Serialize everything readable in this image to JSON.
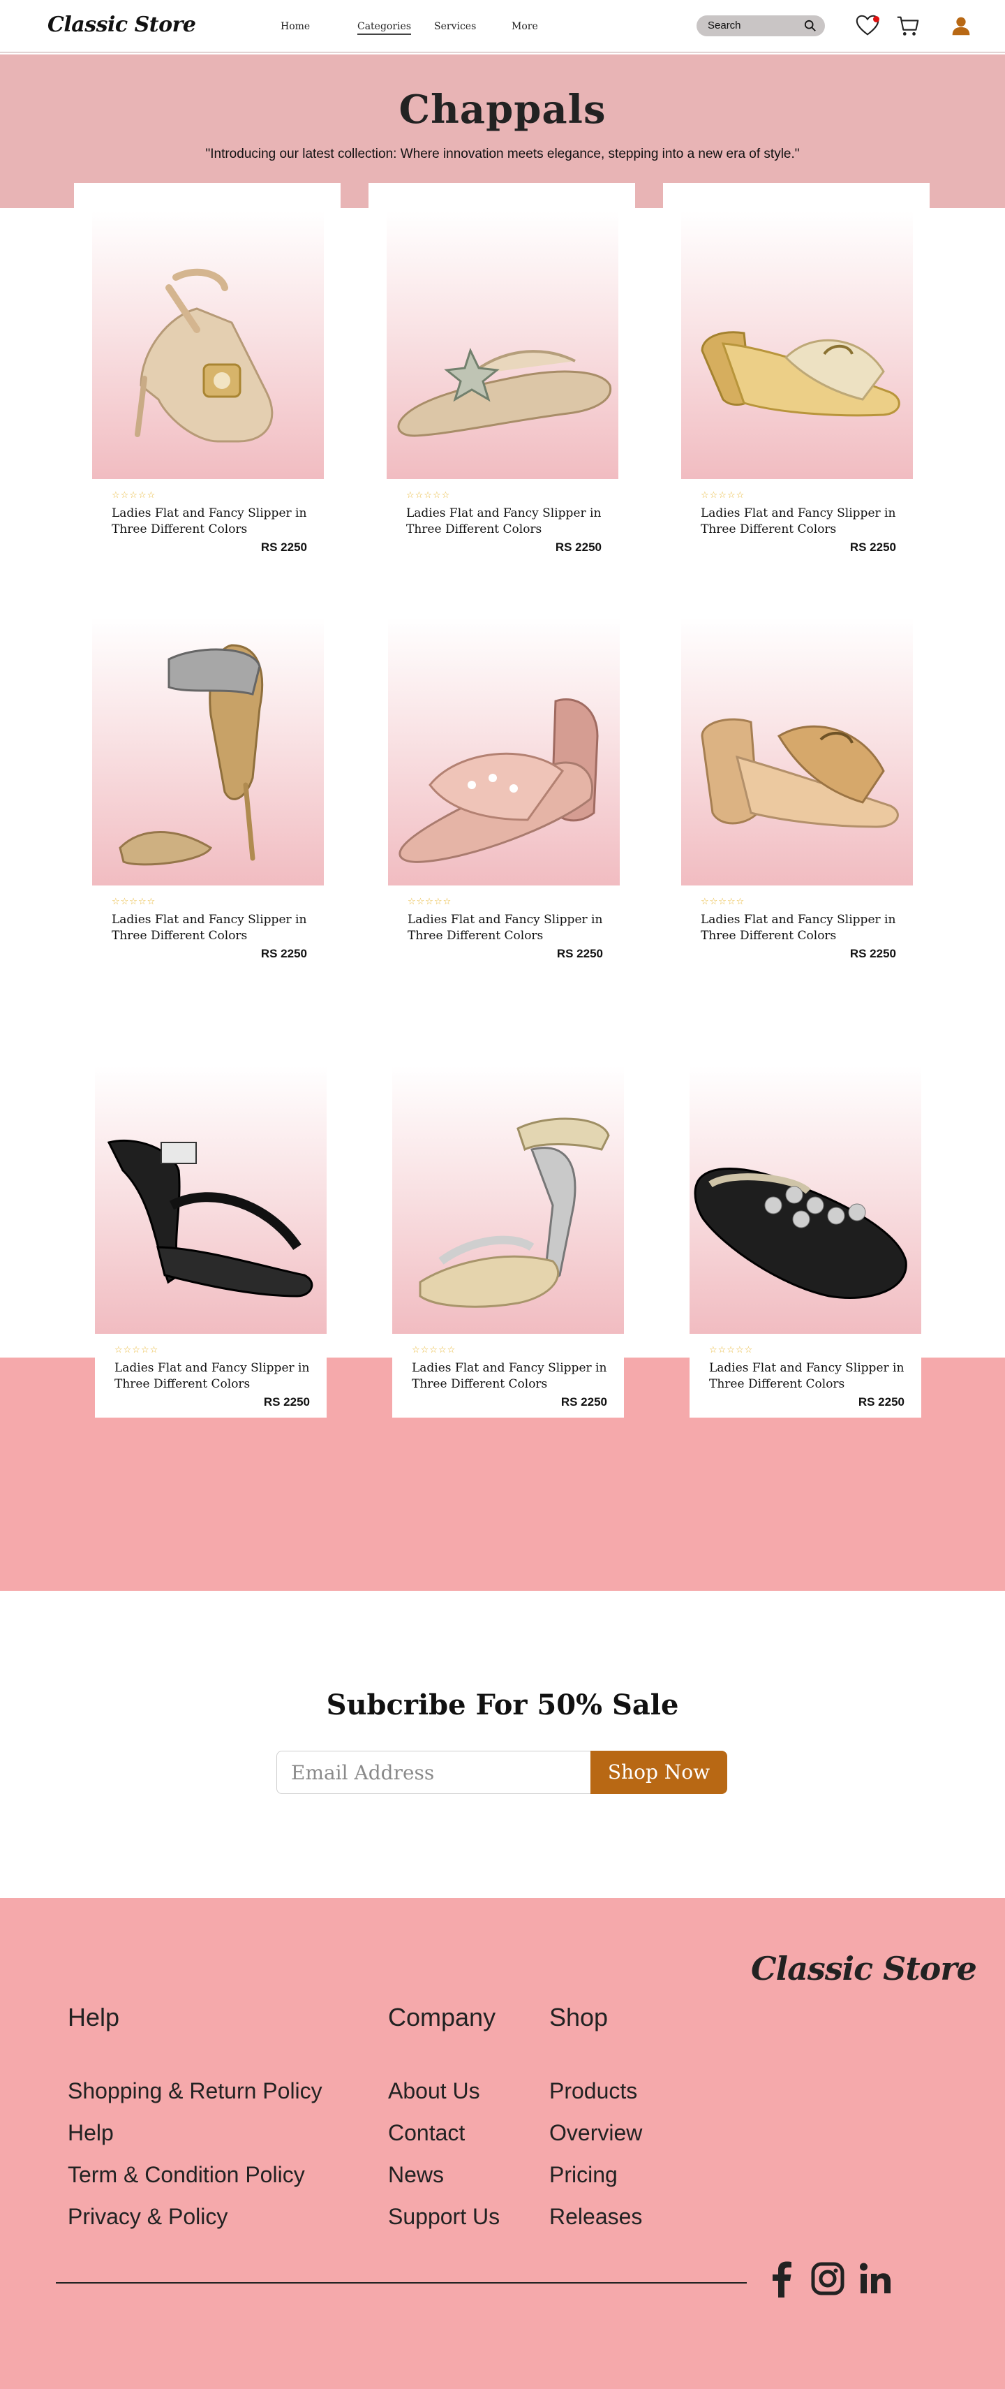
{
  "header": {
    "logo": "Classic Store",
    "nav": [
      "Home",
      "Categories",
      "Services",
      "More"
    ],
    "active_nav": "Categories",
    "search_placeholder": "Search",
    "icons": [
      "heart-icon",
      "cart-icon",
      "user-icon"
    ]
  },
  "hero": {
    "title": "Chappals",
    "subtitle": "\"Introducing our latest collection: Where innovation meets elegance, stepping into a new era of style.\""
  },
  "products": [
    {
      "name": "Ladies Flat and Fancy Slipper in Three Different Colors",
      "price": "RS 2250",
      "rating": 5,
      "stars": "☆☆☆☆☆"
    },
    {
      "name": "Ladies Flat and Fancy Slipper in Three Different Colors",
      "price": "RS 2250",
      "rating": 5,
      "stars": "☆☆☆☆☆"
    },
    {
      "name": "Ladies Flat and Fancy Slipper in Three Different Colors",
      "price": "RS 2250",
      "rating": 5,
      "stars": "☆☆☆☆☆"
    },
    {
      "name": "Ladies Flat and Fancy Slipper in Three Different Colors",
      "price": "RS 2250",
      "rating": 5,
      "stars": "☆☆☆☆☆"
    },
    {
      "name": "Ladies Flat and Fancy Slipper in Three Different Colors",
      "price": "RS 2250",
      "rating": 5,
      "stars": "☆☆☆☆☆"
    },
    {
      "name": "Ladies Flat and Fancy Slipper in Three Different Colors",
      "price": "RS 2250",
      "rating": 5,
      "stars": "☆☆☆☆☆"
    },
    {
      "name": "Ladies Flat and Fancy Slipper in Three Different Colors",
      "price": "RS 2250",
      "rating": 5,
      "stars": "☆☆☆☆☆"
    },
    {
      "name": "Ladies Flat and Fancy Slipper in Three Different Colors",
      "price": "RS 2250",
      "rating": 5,
      "stars": "☆☆☆☆☆"
    },
    {
      "name": "Ladies Flat and Fancy Slipper in Three Different Colors",
      "price": "RS 2250",
      "rating": 5,
      "stars": "☆☆☆☆☆"
    }
  ],
  "subscribe": {
    "title": "Subcribe For 50% Sale",
    "email_placeholder": "Email Address",
    "button": "Shop Now"
  },
  "footer": {
    "logo": "Classic Store",
    "columns": [
      {
        "title": "Help",
        "links": [
          "Shopping & Return Policy",
          "Help",
          "Term & Condition Policy",
          "Privacy & Policy"
        ]
      },
      {
        "title": "Company",
        "links": [
          "About Us",
          "Contact",
          "News",
          "Support Us"
        ]
      },
      {
        "title": "Shop",
        "links": [
          "Products",
          "Overview",
          "Pricing",
          "Releases"
        ]
      }
    ],
    "social": [
      "facebook-icon",
      "instagram-icon",
      "linkedin-icon"
    ]
  },
  "colors": {
    "hero_band": "#e8b4b5",
    "pink_section": "#f5a9ab",
    "accent_button": "#b86814",
    "user_icon": "#b86814",
    "stars": "#e8b83a"
  }
}
